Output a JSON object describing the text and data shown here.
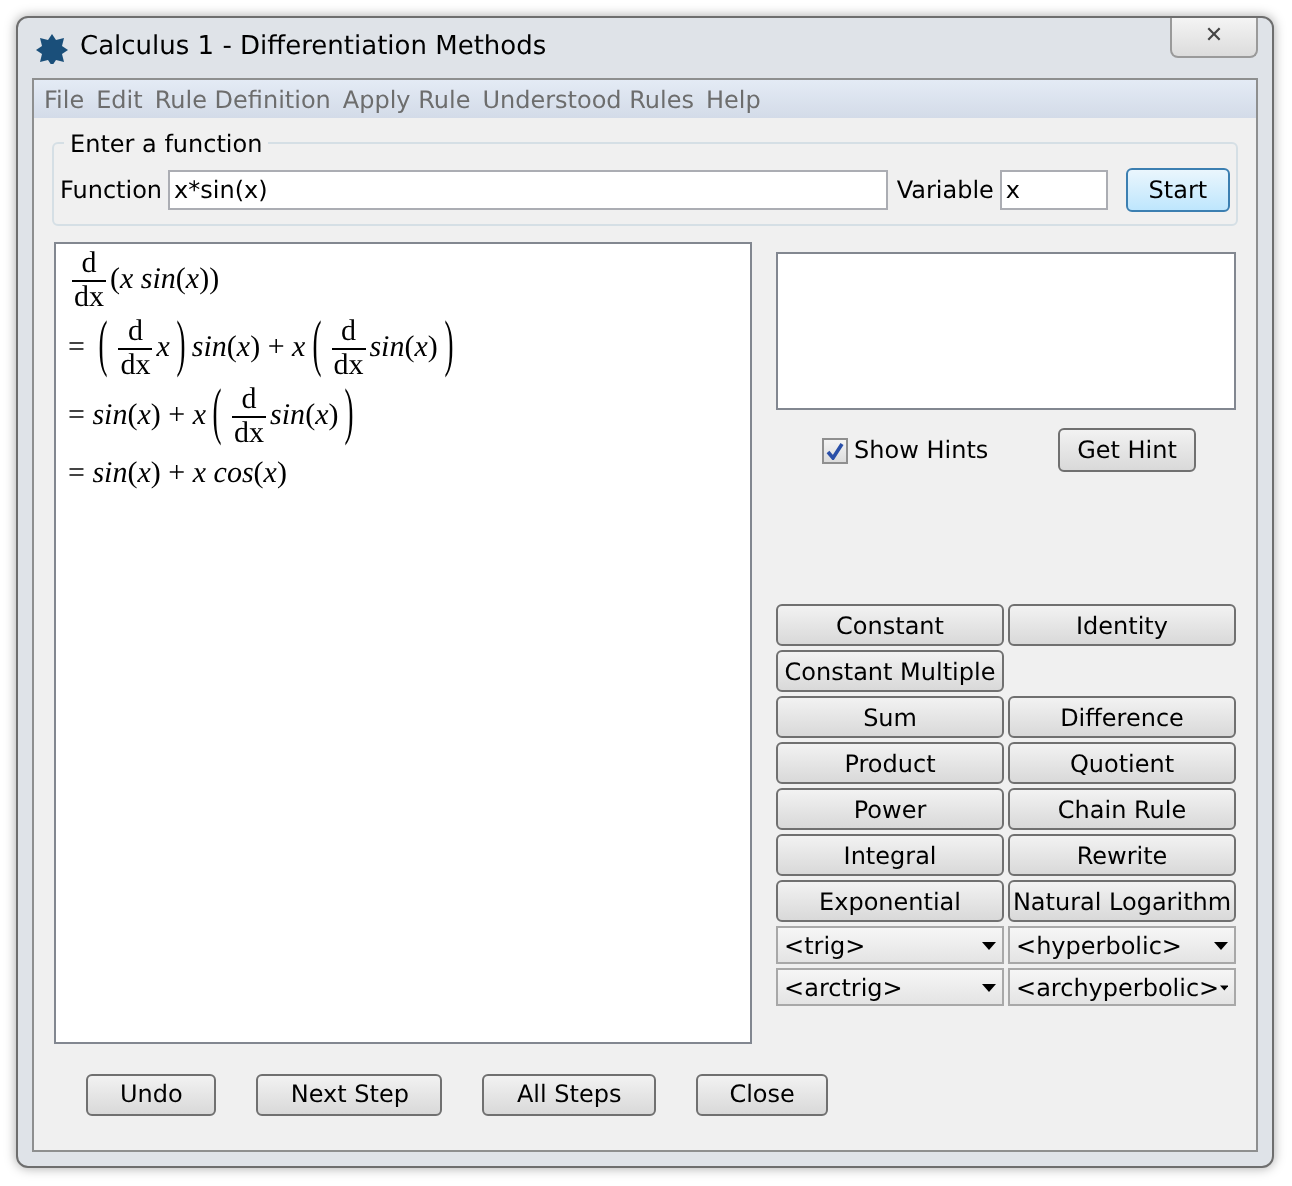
{
  "window": {
    "title": "Calculus 1 - Differentiation Methods",
    "close": "✕"
  },
  "menu": [
    "File",
    "Edit",
    "Rule Definition",
    "Apply Rule",
    "Understood Rules",
    "Help"
  ],
  "input_group": {
    "title": "Enter a function",
    "function_label": "Function",
    "function_value": "x*sin(x)",
    "variable_label": "Variable",
    "variable_value": "x",
    "start_button": "Start"
  },
  "derivation": [
    [
      {
        "kind": "frac",
        "num": "d",
        "den": "dx"
      },
      {
        "kind": "up",
        "text": "("
      },
      {
        "kind": "it",
        "text": "x sin"
      },
      {
        "kind": "up",
        "text": "("
      },
      {
        "kind": "it",
        "text": "x"
      },
      {
        "kind": "up",
        "text": "))"
      }
    ],
    [
      {
        "kind": "up",
        "text": "= "
      },
      {
        "kind": "group",
        "open": "(",
        "close": ")",
        "items": [
          {
            "kind": "frac",
            "num": "d",
            "den": "dx"
          },
          {
            "kind": "it",
            "text": "x"
          }
        ]
      },
      {
        "kind": "it",
        "text": "sin"
      },
      {
        "kind": "up",
        "text": "("
      },
      {
        "kind": "it",
        "text": "x"
      },
      {
        "kind": "up",
        "text": ") + "
      },
      {
        "kind": "it",
        "text": "x"
      },
      {
        "kind": "group",
        "open": "(",
        "close": ")",
        "items": [
          {
            "kind": "frac",
            "num": "d",
            "den": "dx"
          },
          {
            "kind": "it",
            "text": "sin"
          },
          {
            "kind": "up",
            "text": "("
          },
          {
            "kind": "it",
            "text": "x"
          },
          {
            "kind": "up",
            "text": ")"
          }
        ]
      }
    ],
    [
      {
        "kind": "up",
        "text": "= "
      },
      {
        "kind": "it",
        "text": "sin"
      },
      {
        "kind": "up",
        "text": "("
      },
      {
        "kind": "it",
        "text": "x"
      },
      {
        "kind": "up",
        "text": ") + "
      },
      {
        "kind": "it",
        "text": "x"
      },
      {
        "kind": "group",
        "open": "(",
        "close": ")",
        "items": [
          {
            "kind": "frac",
            "num": "d",
            "den": "dx"
          },
          {
            "kind": "it",
            "text": "sin"
          },
          {
            "kind": "up",
            "text": "("
          },
          {
            "kind": "it",
            "text": "x"
          },
          {
            "kind": "up",
            "text": ")"
          }
        ]
      }
    ],
    [
      {
        "kind": "up",
        "text": "= "
      },
      {
        "kind": "it",
        "text": "sin"
      },
      {
        "kind": "up",
        "text": "("
      },
      {
        "kind": "it",
        "text": "x"
      },
      {
        "kind": "up",
        "text": ") + "
      },
      {
        "kind": "it",
        "text": "x cos"
      },
      {
        "kind": "up",
        "text": "("
      },
      {
        "kind": "it",
        "text": "x"
      },
      {
        "kind": "up",
        "text": ")"
      }
    ]
  ],
  "hints": {
    "show_hints": {
      "label": "Show Hints",
      "checked": true
    },
    "get_hint_button": "Get Hint"
  },
  "rules": [
    [
      {
        "kind": "button",
        "label": "Constant"
      },
      {
        "kind": "button",
        "label": "Identity"
      }
    ],
    [
      {
        "kind": "button",
        "label": "Constant Multiple"
      }
    ],
    [
      {
        "kind": "button",
        "label": "Sum"
      },
      {
        "kind": "button",
        "label": "Difference"
      }
    ],
    [
      {
        "kind": "button",
        "label": "Product"
      },
      {
        "kind": "button",
        "label": "Quotient"
      }
    ],
    [
      {
        "kind": "button",
        "label": "Power"
      },
      {
        "kind": "button",
        "label": "Chain Rule"
      }
    ],
    [
      {
        "kind": "button",
        "label": "Integral"
      },
      {
        "kind": "button",
        "label": "Rewrite"
      }
    ],
    [
      {
        "kind": "button",
        "label": "Exponential"
      },
      {
        "kind": "button",
        "label": "Natural Logarithm"
      }
    ],
    [
      {
        "kind": "dropdown",
        "label": "<trig>"
      },
      {
        "kind": "dropdown",
        "label": "<hyperbolic>"
      }
    ],
    [
      {
        "kind": "dropdown",
        "label": "<arctrig>"
      },
      {
        "kind": "dropdown",
        "label": "<archyperbolic>"
      }
    ]
  ],
  "bottom_buttons": [
    "Undo",
    "Next Step",
    "All Steps",
    "Close"
  ]
}
